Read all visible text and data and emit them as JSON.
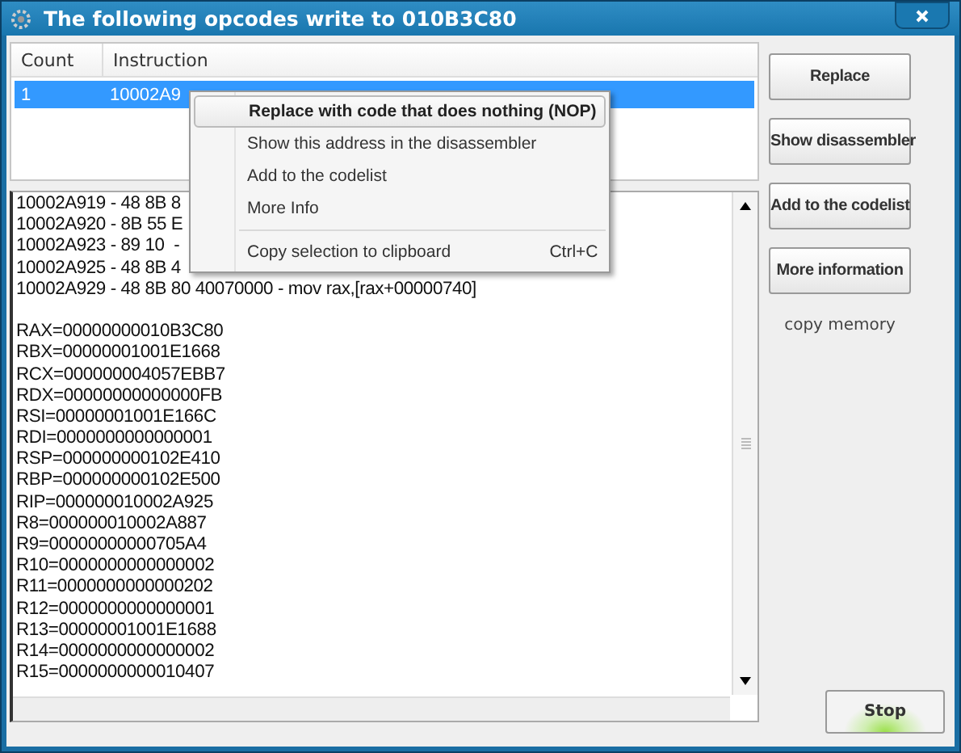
{
  "window": {
    "title": "The following opcodes write to 010B3C80"
  },
  "list": {
    "columns": [
      "Count",
      "Instruction"
    ],
    "rows": [
      {
        "count": "1",
        "instruction": "10002A9",
        "selected": true
      }
    ]
  },
  "context_menu": [
    {
      "label": "Replace with code that does nothing (NOP)",
      "selected": true,
      "separator_before": false
    },
    {
      "label": "Show this address in the disassembler",
      "selected": false,
      "separator_before": false
    },
    {
      "label": "Add to the codelist",
      "selected": false,
      "separator_before": false
    },
    {
      "label": "More Info",
      "selected": false,
      "separator_before": false
    },
    {
      "label": "Copy selection to clipboard",
      "shortcut": "Ctrl+C",
      "selected": false,
      "separator_before": true
    }
  ],
  "trace": [
    "10002A919 - 48 8B 8",
    "10002A920 - 8B 55 E",
    "10002A923 - 89 10  -",
    "10002A925 - 48 8B 4",
    "10002A929 - 48 8B 80 40070000 - mov rax,[rax+00000740]"
  ],
  "registers": [
    "RAX=00000000010B3C80",
    "RBX=00000001001E1668",
    "RCX=000000004057EBB7",
    "RDX=00000000000000FB",
    "RSI=00000001001E166C",
    "RDI=0000000000000001",
    "RSP=000000000102E410",
    "RBP=000000000102E500",
    "RIP=000000010002A925",
    "R8=000000010002A887",
    "R9=00000000000705A4",
    "R10=0000000000000002",
    "R11=0000000000000202",
    "R12=0000000000000001",
    "R13=00000001001E1688",
    "R14=0000000000000002",
    "R15=0000000000010407"
  ],
  "buttons": [
    "Replace",
    "Show disassembler",
    "Add to the codelist",
    "More information"
  ],
  "copy_memory": "copy memory",
  "stop_button": "Stop"
}
